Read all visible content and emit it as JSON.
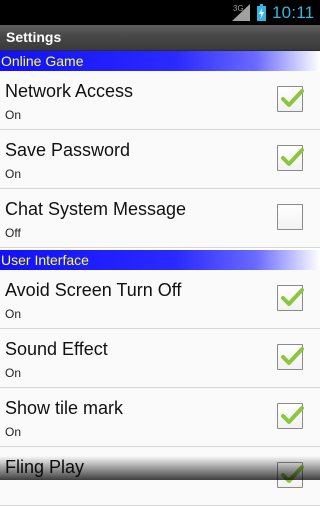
{
  "status": {
    "network": "3G",
    "time": "10:11"
  },
  "title": "Settings",
  "sections": [
    {
      "header": "Online Game",
      "items": [
        {
          "label": "Network Access",
          "summary": "On",
          "checked": true
        },
        {
          "label": "Save Password",
          "summary": "On",
          "checked": true
        },
        {
          "label": "Chat System Message",
          "summary": "Off",
          "checked": false
        }
      ]
    },
    {
      "header": "User Interface",
      "items": [
        {
          "label": "Avoid Screen Turn Off",
          "summary": "On",
          "checked": true
        },
        {
          "label": "Sound Effect",
          "summary": "On",
          "checked": true
        },
        {
          "label": "Show tile mark",
          "summary": "On",
          "checked": true
        },
        {
          "label": "Fling Play",
          "summary": "",
          "checked": true
        }
      ]
    }
  ],
  "colors": {
    "section_bg": "#1010ff",
    "section_text": "#ffff3a",
    "check_green": "#8cc63f",
    "clock": "#33b5e5"
  }
}
